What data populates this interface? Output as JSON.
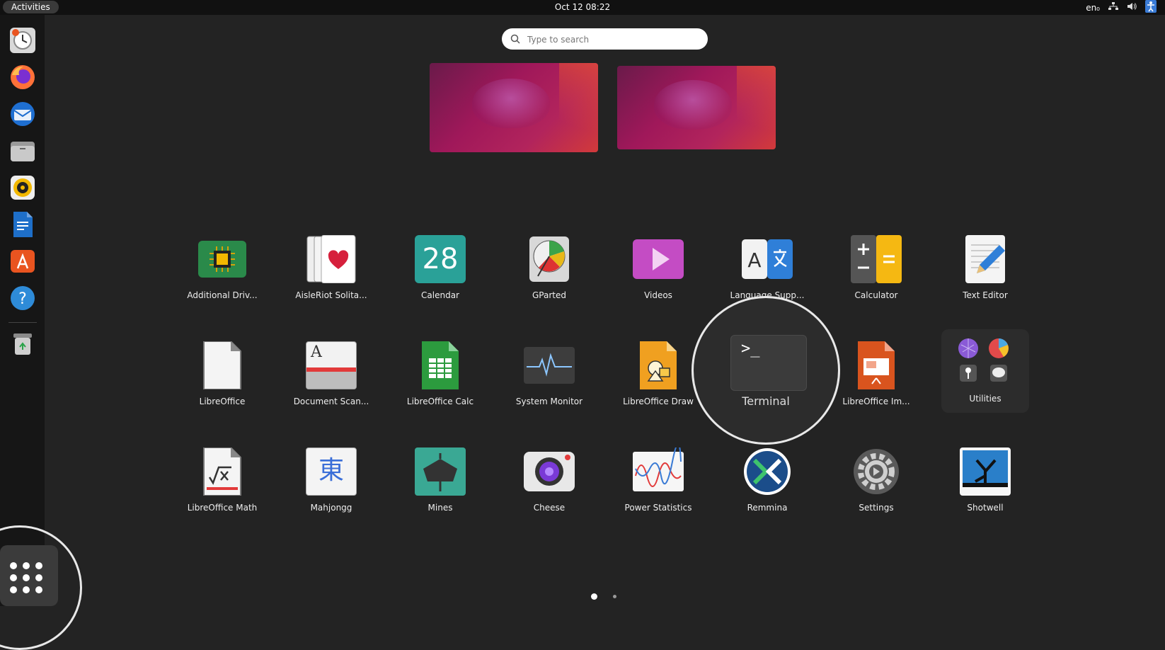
{
  "topbar": {
    "activities": "Activities",
    "clock": "Oct 12  08:22",
    "lang": "en₀"
  },
  "search": {
    "placeholder": "Type to search"
  },
  "apps": [
    {
      "label": "Additional Driv..."
    },
    {
      "label": "AisleRiot Solita..."
    },
    {
      "label": "Calendar",
      "icon_text": "28"
    },
    {
      "label": "GParted"
    },
    {
      "label": "Videos"
    },
    {
      "label": "Language Supp..."
    },
    {
      "label": "Calculator"
    },
    {
      "label": "Text Editor"
    },
    {
      "label": "LibreOffice"
    },
    {
      "label": "Document Scan...",
      "icon_text": "A"
    },
    {
      "label": "LibreOffice Calc"
    },
    {
      "label": "System Monitor"
    },
    {
      "label": "LibreOffice Draw"
    },
    {
      "label": "Terminal",
      "icon_text": ">_"
    },
    {
      "label": "LibreOffice Im..."
    },
    {
      "label": "Utilities"
    },
    {
      "label": "LibreOffice Math"
    },
    {
      "label": "Mahjongg",
      "icon_text": "東"
    },
    {
      "label": "Mines"
    },
    {
      "label": "Cheese"
    },
    {
      "label": "Power Statistics"
    },
    {
      "label": "Remmina"
    },
    {
      "label": "Settings"
    },
    {
      "label": "Shotwell"
    }
  ],
  "colors": {
    "accent": "#e95420",
    "panel": "#111111",
    "dock": "#161616",
    "background": "#232323"
  }
}
